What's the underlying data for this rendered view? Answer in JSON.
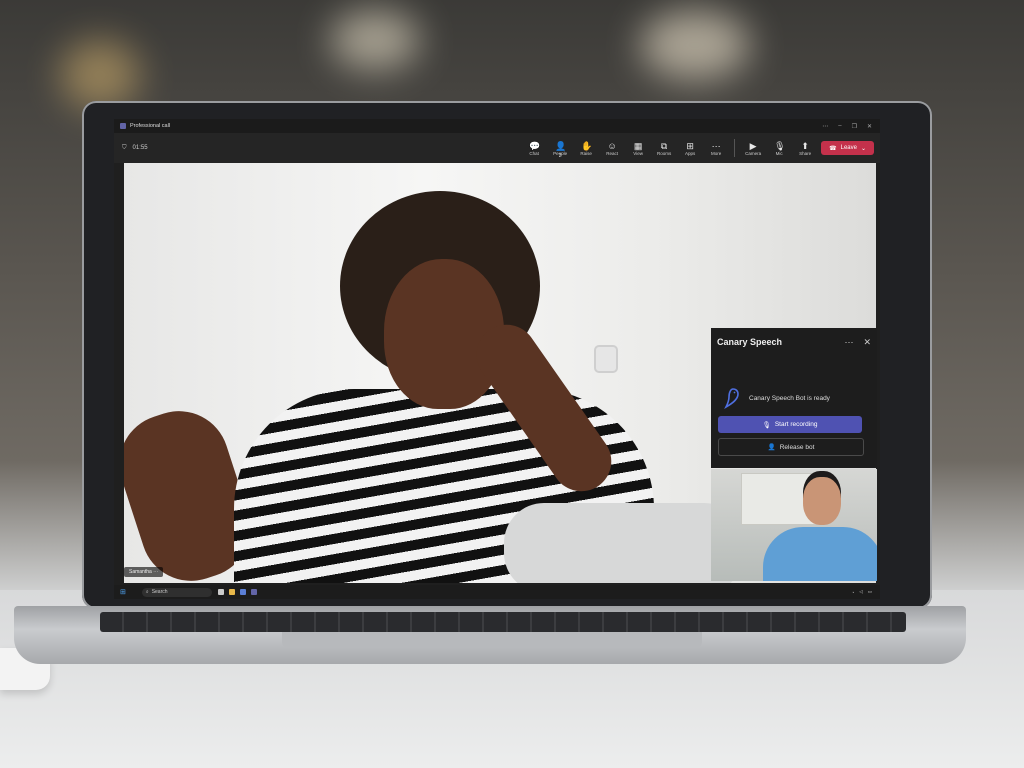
{
  "window": {
    "title": "Professional call"
  },
  "call": {
    "duration": "01:55"
  },
  "toolbar": {
    "items": [
      {
        "label": "Chat",
        "icon": "chat-icon"
      },
      {
        "label": "People",
        "icon": "people-icon",
        "count": "2"
      },
      {
        "label": "Raise",
        "icon": "raise-hand-icon"
      },
      {
        "label": "React",
        "icon": "react-icon"
      },
      {
        "label": "View",
        "icon": "view-icon"
      },
      {
        "label": "Rooms",
        "icon": "rooms-icon"
      },
      {
        "label": "Apps",
        "icon": "apps-icon"
      },
      {
        "label": "More",
        "icon": "more-icon"
      },
      {
        "label": "Camera",
        "icon": "camera-icon"
      },
      {
        "label": "Mic",
        "icon": "mic-icon"
      },
      {
        "label": "Share",
        "icon": "share-icon"
      }
    ],
    "leave_label": "Leave",
    "leave_color": "#c4314b"
  },
  "participant": {
    "name": "Samantha"
  },
  "panel": {
    "title": "Canary Speech",
    "status": "Canary Speech Bot is ready",
    "start_label": "Start recording",
    "release_label": "Release bot",
    "accent": "#4f52b2"
  },
  "taskbar": {
    "search_placeholder": "Search"
  }
}
